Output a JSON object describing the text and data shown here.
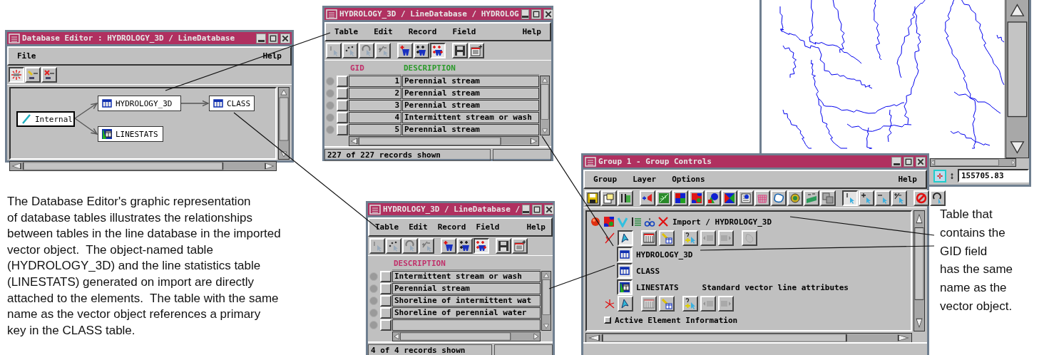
{
  "database_editor": {
    "title": "Database Editor : HYDROLOGY_3D / LineDatabase",
    "menu": [
      "File",
      "Help"
    ],
    "tools": [
      {
        "selected": true
      },
      {
        "selected": false
      },
      {
        "selected": false
      }
    ],
    "nodes": [
      {
        "label": "Internal",
        "kind": "element"
      },
      {
        "label": "HYDROLOGY_3D",
        "kind": "table"
      },
      {
        "label": "CLASS",
        "kind": "table"
      },
      {
        "label": "LINESTATS",
        "kind": "stats"
      }
    ]
  },
  "table_windows": [
    {
      "title": "HYDROLOGY_3D / LineDatabase / HYDROLOG",
      "menu": [
        "Table",
        "Edit",
        "Record",
        "Field",
        "Help"
      ],
      "tools": [
        {
          "selected": false
        },
        {
          "selected": false
        },
        {
          "selected": false
        },
        {
          "selected": false
        },
        {
          "selected": false
        },
        {
          "selected": false
        },
        {
          "selected": true
        },
        {
          "selected": false
        },
        {
          "selected": false
        }
      ],
      "columns": [
        {
          "label": "GID",
          "color": "#c0306a"
        },
        {
          "label": "DESCRIPTION",
          "color": "#2a9a2a"
        }
      ],
      "rows": [
        {
          "cells": [
            "1",
            "Perennial stream"
          ]
        },
        {
          "cells": [
            "2",
            "Perennial stream"
          ]
        },
        {
          "cells": [
            "3",
            "Perennial stream"
          ]
        },
        {
          "cells": [
            "4",
            "Intermittent stream or wash"
          ]
        },
        {
          "cells": [
            "5",
            "Perennial stream"
          ]
        }
      ],
      "status": "227 of 227 records shown"
    },
    {
      "title": "HYDROLOGY_3D / LineDatabase /",
      "menu": [
        "Table",
        "Edit",
        "Record",
        "Field",
        "Help"
      ],
      "tools": [
        {
          "selected": false
        },
        {
          "selected": false
        },
        {
          "selected": false
        },
        {
          "selected": false
        },
        {
          "selected": false
        },
        {
          "selected": false
        },
        {
          "selected": true
        },
        {
          "selected": false
        },
        {
          "selected": false
        }
      ],
      "columns": [
        {
          "label": "DESCRIPTION",
          "color": "#c0306a"
        }
      ],
      "rows": [
        {
          "cells": [
            "Intermittent stream or wash"
          ]
        },
        {
          "cells": [
            "Perennial stream"
          ]
        },
        {
          "cells": [
            "Shoreline of intermittent wat"
          ]
        },
        {
          "cells": [
            "Shoreline of perennial water"
          ]
        }
      ],
      "status": "4 of 4 records shown"
    }
  ],
  "map": {
    "coordinate": "155705.83"
  },
  "group_controls": {
    "title": "Group 1 - Group Controls",
    "menu": [
      "Group",
      "Layer",
      "Options",
      "Help"
    ],
    "tools": [
      {
        "selected": false
      },
      {
        "selected": false
      },
      {
        "selected": false
      },
      {
        "selected": false
      },
      {
        "selected": false
      },
      {
        "selected": false
      },
      {
        "selected": false
      },
      {
        "selected": false
      },
      {
        "selected": false
      },
      {
        "selected": false
      },
      {
        "selected": false
      },
      {
        "selected": false
      },
      {
        "selected": false
      },
      {
        "selected": false
      },
      {
        "selected": false
      },
      {
        "selected": true
      },
      {
        "selected": false
      },
      {
        "selected": false
      },
      {
        "selected": false
      },
      {
        "selected": false
      },
      {
        "selected": false
      }
    ],
    "layer": {
      "label": "Import / HYDROLOGY_3D"
    },
    "line_tools": [
      {
        "selected": true,
        "disabled": false
      },
      {
        "selected": false,
        "disabled": false
      },
      {
        "selected": false,
        "disabled": false
      },
      {
        "selected": false,
        "disabled": false
      },
      {
        "selected": false,
        "disabled": true
      },
      {
        "selected": false,
        "disabled": true
      },
      {
        "selected": false,
        "disabled": true
      }
    ],
    "tables": [
      {
        "name": "HYDROLOGY_3D"
      },
      {
        "name": "CLASS"
      },
      {
        "name": "LINESTATS",
        "description": "Standard vector line attributes"
      }
    ],
    "node_tools": [
      {
        "selected": false,
        "disabled": false
      },
      {
        "selected": false,
        "disabled": true
      },
      {
        "selected": false,
        "disabled": false
      },
      {
        "selected": false,
        "disabled": false
      },
      {
        "selected": false,
        "disabled": true
      },
      {
        "selected": false,
        "disabled": true
      }
    ],
    "active_element_info": {
      "label": "Active Element Information",
      "checked": false
    }
  },
  "description": "The Database Editor's graphic representation\nof database tables illustrates the relationships\nbetween tables in the line database in the imported\nvector object.  The object-named table\n(HYDROLOGY_3D) and the line statistics table\n(LINESTATS) generated on import are directly\nattached to the elements.  The table with the same\nname as the vector object references a primary\nkey in the CLASS table.",
  "callout": "Table that\ncontains the\nGID field\nhas the same\nname as the\nvector object."
}
